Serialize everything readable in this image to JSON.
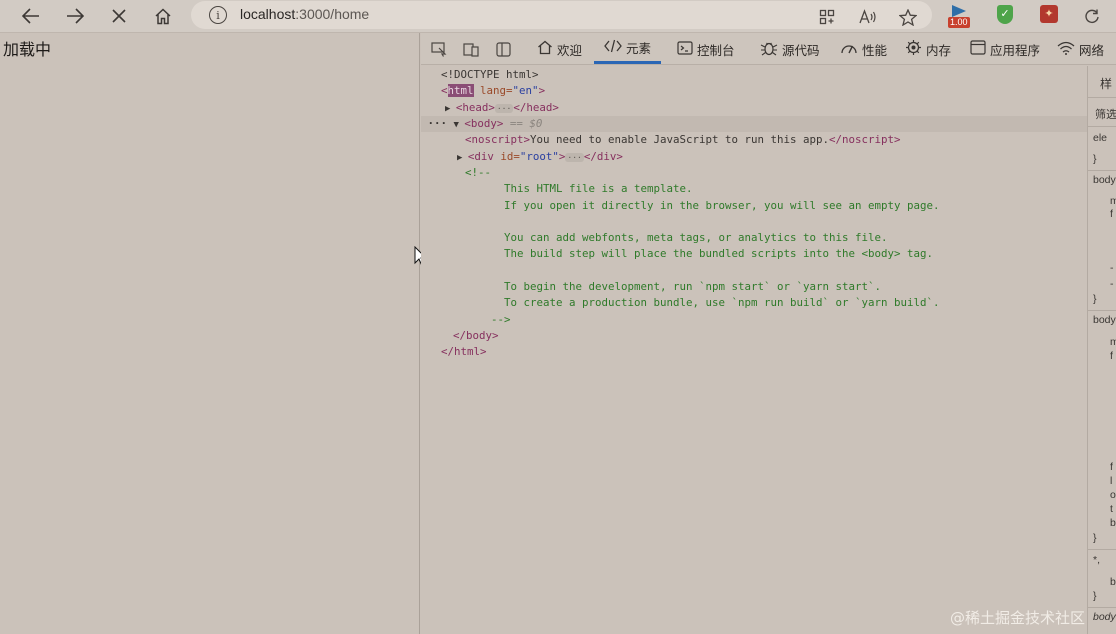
{
  "browser": {
    "url_host": "localhost",
    "url_path": ":3000/home",
    "extension_badge": "1.00"
  },
  "page": {
    "loading_text": "加载中"
  },
  "devtools": {
    "tabs": [
      {
        "label": "欢迎",
        "icon": "home-icon"
      },
      {
        "label": "元素",
        "icon": "code-icon"
      },
      {
        "label": "控制台",
        "icon": "console-icon"
      },
      {
        "label": "源代码",
        "icon": "bug-icon"
      },
      {
        "label": "性能",
        "icon": "gauge-icon"
      },
      {
        "label": "内存",
        "icon": "chip-icon"
      },
      {
        "label": "应用程序",
        "icon": "window-icon"
      },
      {
        "label": "网络",
        "icon": "wifi-icon"
      }
    ],
    "dom": {
      "doctype": "<!DOCTYPE html>",
      "html_open_lt": "<",
      "html_tag": "html",
      "html_attr": " lang=",
      "html_attr_val": "\"en\"",
      "html_close_gt": ">",
      "head_open": "<head>",
      "head_close": "</head>",
      "body_open": "<body>",
      "body_eq": " == $0",
      "noscript_open": "<noscript>",
      "noscript_text": "You need to enable JavaScript to run this app.",
      "noscript_close": "</noscript>",
      "div_open_lt": "<div",
      "div_attr": " id=",
      "div_attr_val": "\"root\"",
      "div_open_gt": ">",
      "div_close": "</div>",
      "comment_open": "<!--",
      "comment_lines": [
        "This HTML file is a template.",
        "If you open it directly in the browser, you will see an empty page.",
        "",
        "You can add webfonts, meta tags, or analytics to this file.",
        "The build step will place the bundled scripts into the <body> tag.",
        "",
        "To begin the development, run `npm start` or `yarn start`.",
        "To create a production bundle, use `npm run build` or `yarn build`."
      ],
      "comment_close": "-->",
      "body_close": "</body>",
      "html_close": "</html>"
    },
    "styles_pane": {
      "header": "样",
      "filter": "筛选",
      "rows": [
        "ele",
        "}",
        "body",
        "m",
        "f",
        "",
        "-",
        "-",
        "}",
        "body",
        "m",
        "f",
        "f",
        "l",
        "o",
        "t",
        "b",
        "}",
        "*, ",
        "b",
        "}",
        "body"
      ]
    }
  },
  "watermark": "@稀土掘金技术社区"
}
